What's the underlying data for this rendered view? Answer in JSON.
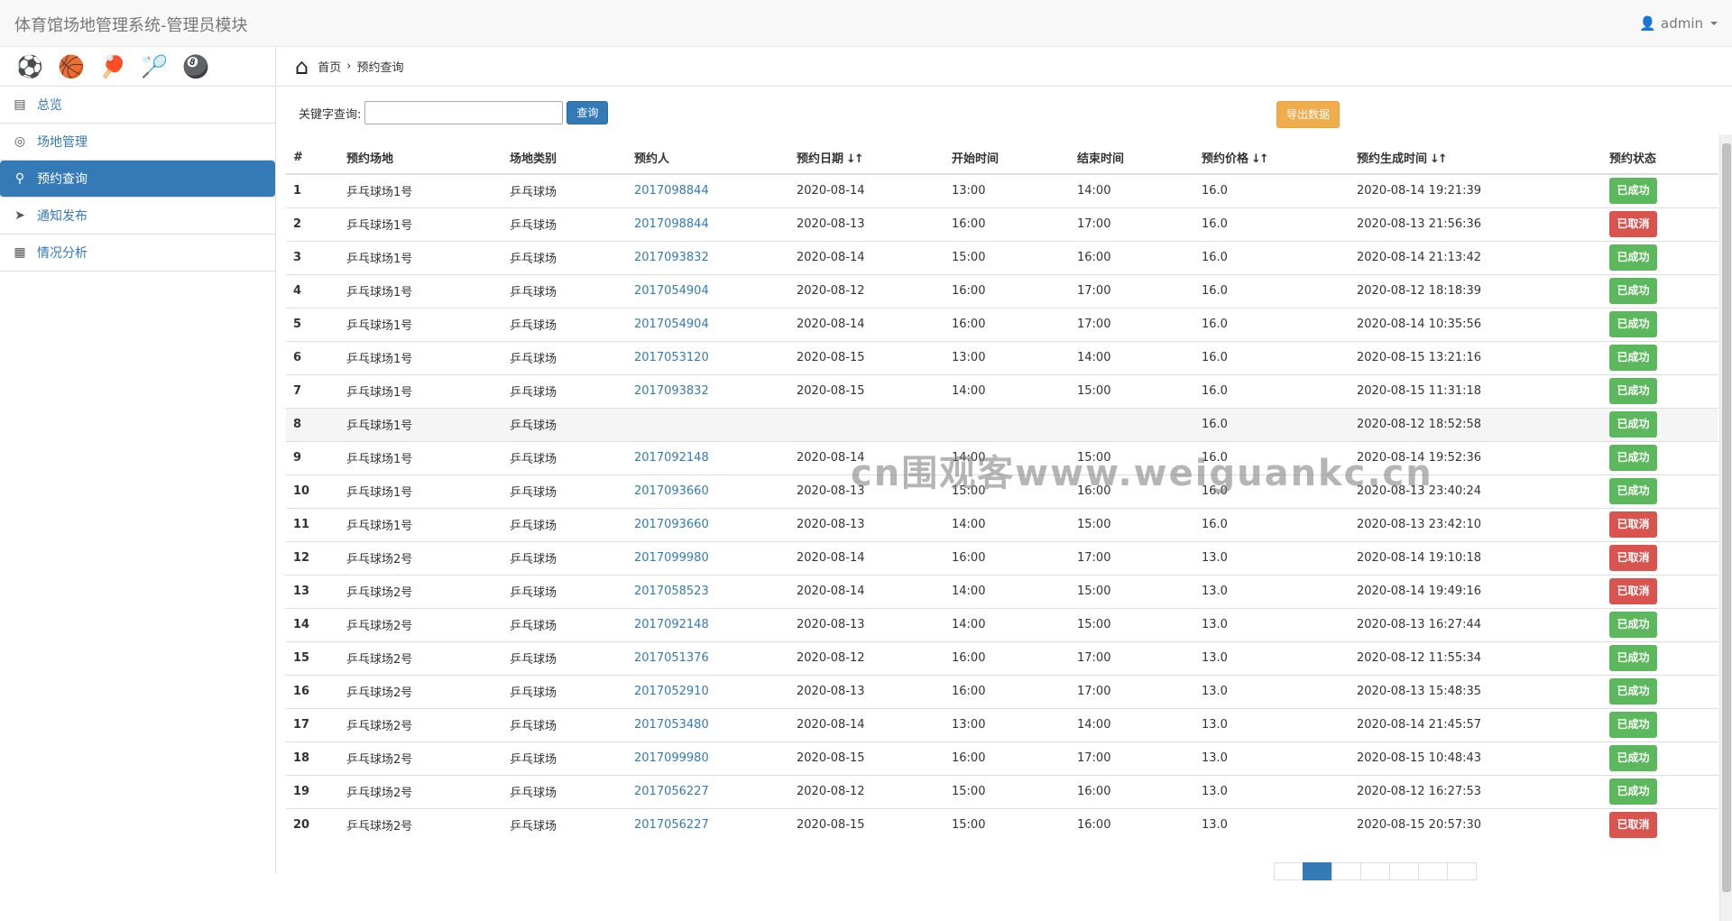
{
  "app": {
    "title": "体育馆场地管理系统-管理员模块",
    "user": "admin"
  },
  "sports_icons": [
    "soccer-ball-icon",
    "basketball-icon",
    "ping-pong-icon",
    "badminton-icon",
    "billiards-icon"
  ],
  "sidebar": {
    "items": [
      {
        "label": "总览",
        "icon": "dashboard-icon",
        "glyph": "▤"
      },
      {
        "label": "场地管理",
        "icon": "venue-icon",
        "glyph": "◎"
      },
      {
        "label": "预约查询",
        "icon": "search-icon",
        "glyph": "⚲",
        "active": true
      },
      {
        "label": "通知发布",
        "icon": "paper-plane-icon",
        "glyph": "➤"
      },
      {
        "label": "情况分析",
        "icon": "analysis-icon",
        "glyph": "▦"
      }
    ]
  },
  "breadcrumb": {
    "home": "首页",
    "current": "预约查询"
  },
  "search": {
    "label": "关键字查询:",
    "value": "",
    "button": "查询"
  },
  "export_button": "导出数据",
  "table": {
    "headers": [
      "#",
      "预约场地",
      "场地类别",
      "预约人",
      "预约日期",
      "开始时间",
      "结束时间",
      "预约价格",
      "预约生成时间",
      "预约状态"
    ],
    "sortable": [
      false,
      false,
      false,
      false,
      true,
      false,
      false,
      true,
      true,
      false
    ],
    "rows": [
      [
        "1",
        "乒乓球场1号",
        "乒乓球场",
        "2017098844",
        "2020-08-14",
        "13:00",
        "14:00",
        "16.0",
        "2020-08-14 19:21:39",
        "已成功"
      ],
      [
        "2",
        "乒乓球场1号",
        "乒乓球场",
        "2017098844",
        "2020-08-13",
        "16:00",
        "17:00",
        "16.0",
        "2020-08-13 21:56:36",
        "已取消"
      ],
      [
        "3",
        "乒乓球场1号",
        "乒乓球场",
        "2017093832",
        "2020-08-14",
        "15:00",
        "16:00",
        "16.0",
        "2020-08-14 21:13:42",
        "已成功"
      ],
      [
        "4",
        "乒乓球场1号",
        "乒乓球场",
        "2017054904",
        "2020-08-12",
        "16:00",
        "17:00",
        "16.0",
        "2020-08-12 18:18:39",
        "已成功"
      ],
      [
        "5",
        "乒乓球场1号",
        "乒乓球场",
        "2017054904",
        "2020-08-14",
        "16:00",
        "17:00",
        "16.0",
        "2020-08-14 10:35:56",
        "已成功"
      ],
      [
        "6",
        "乒乓球场1号",
        "乒乓球场",
        "2017053120",
        "2020-08-15",
        "13:00",
        "14:00",
        "16.0",
        "2020-08-15 13:21:16",
        "已成功"
      ],
      [
        "7",
        "乒乓球场1号",
        "乒乓球场",
        "2017093832",
        "2020-08-15",
        "14:00",
        "15:00",
        "16.0",
        "2020-08-15 11:31:18",
        "已成功"
      ],
      [
        "8",
        "乒乓球场1号",
        "乒乓球场",
        "",
        "",
        "",
        "",
        "16.0",
        "2020-08-12 18:52:58",
        "已成功"
      ],
      [
        "9",
        "乒乓球场1号",
        "乒乓球场",
        "2017092148",
        "2020-08-14",
        "14:00",
        "15:00",
        "16.0",
        "2020-08-14 19:52:36",
        "已成功"
      ],
      [
        "10",
        "乒乓球场1号",
        "乒乓球场",
        "2017093660",
        "2020-08-13",
        "15:00",
        "16:00",
        "16.0",
        "2020-08-13 23:40:24",
        "已成功"
      ],
      [
        "11",
        "乒乓球场1号",
        "乒乓球场",
        "2017093660",
        "2020-08-13",
        "14:00",
        "15:00",
        "16.0",
        "2020-08-13 23:42:10",
        "已取消"
      ],
      [
        "12",
        "乒乓球场2号",
        "乒乓球场",
        "2017099980",
        "2020-08-14",
        "16:00",
        "17:00",
        "13.0",
        "2020-08-14 19:10:18",
        "已取消"
      ],
      [
        "13",
        "乒乓球场2号",
        "乒乓球场",
        "2017058523",
        "2020-08-14",
        "14:00",
        "15:00",
        "13.0",
        "2020-08-14 19:49:16",
        "已取消"
      ],
      [
        "14",
        "乒乓球场2号",
        "乒乓球场",
        "2017092148",
        "2020-08-13",
        "14:00",
        "15:00",
        "13.0",
        "2020-08-13 16:27:44",
        "已成功"
      ],
      [
        "15",
        "乒乓球场2号",
        "乒乓球场",
        "2017051376",
        "2020-08-12",
        "16:00",
        "17:00",
        "13.0",
        "2020-08-12 11:55:34",
        "已成功"
      ],
      [
        "16",
        "乒乓球场2号",
        "乒乓球场",
        "2017052910",
        "2020-08-13",
        "16:00",
        "17:00",
        "13.0",
        "2020-08-13 15:48:35",
        "已成功"
      ],
      [
        "17",
        "乒乓球场2号",
        "乒乓球场",
        "2017053480",
        "2020-08-14",
        "13:00",
        "14:00",
        "13.0",
        "2020-08-14 21:45:57",
        "已成功"
      ],
      [
        "18",
        "乒乓球场2号",
        "乒乓球场",
        "2017099980",
        "2020-08-15",
        "16:00",
        "17:00",
        "13.0",
        "2020-08-15 10:48:43",
        "已成功"
      ],
      [
        "19",
        "乒乓球场2号",
        "乒乓球场",
        "2017056227",
        "2020-08-12",
        "15:00",
        "16:00",
        "13.0",
        "2020-08-12 16:27:53",
        "已成功"
      ],
      [
        "20",
        "乒乓球场2号",
        "乒乓球场",
        "2017056227",
        "2020-08-15",
        "15:00",
        "16:00",
        "13.0",
        "2020-08-15 20:57:30",
        "已取消"
      ]
    ]
  },
  "status_colors": {
    "已成功": "#5cb85c",
    "已取消": "#d9534f"
  },
  "watermark": "cn围观客www.weiguankc.cn"
}
